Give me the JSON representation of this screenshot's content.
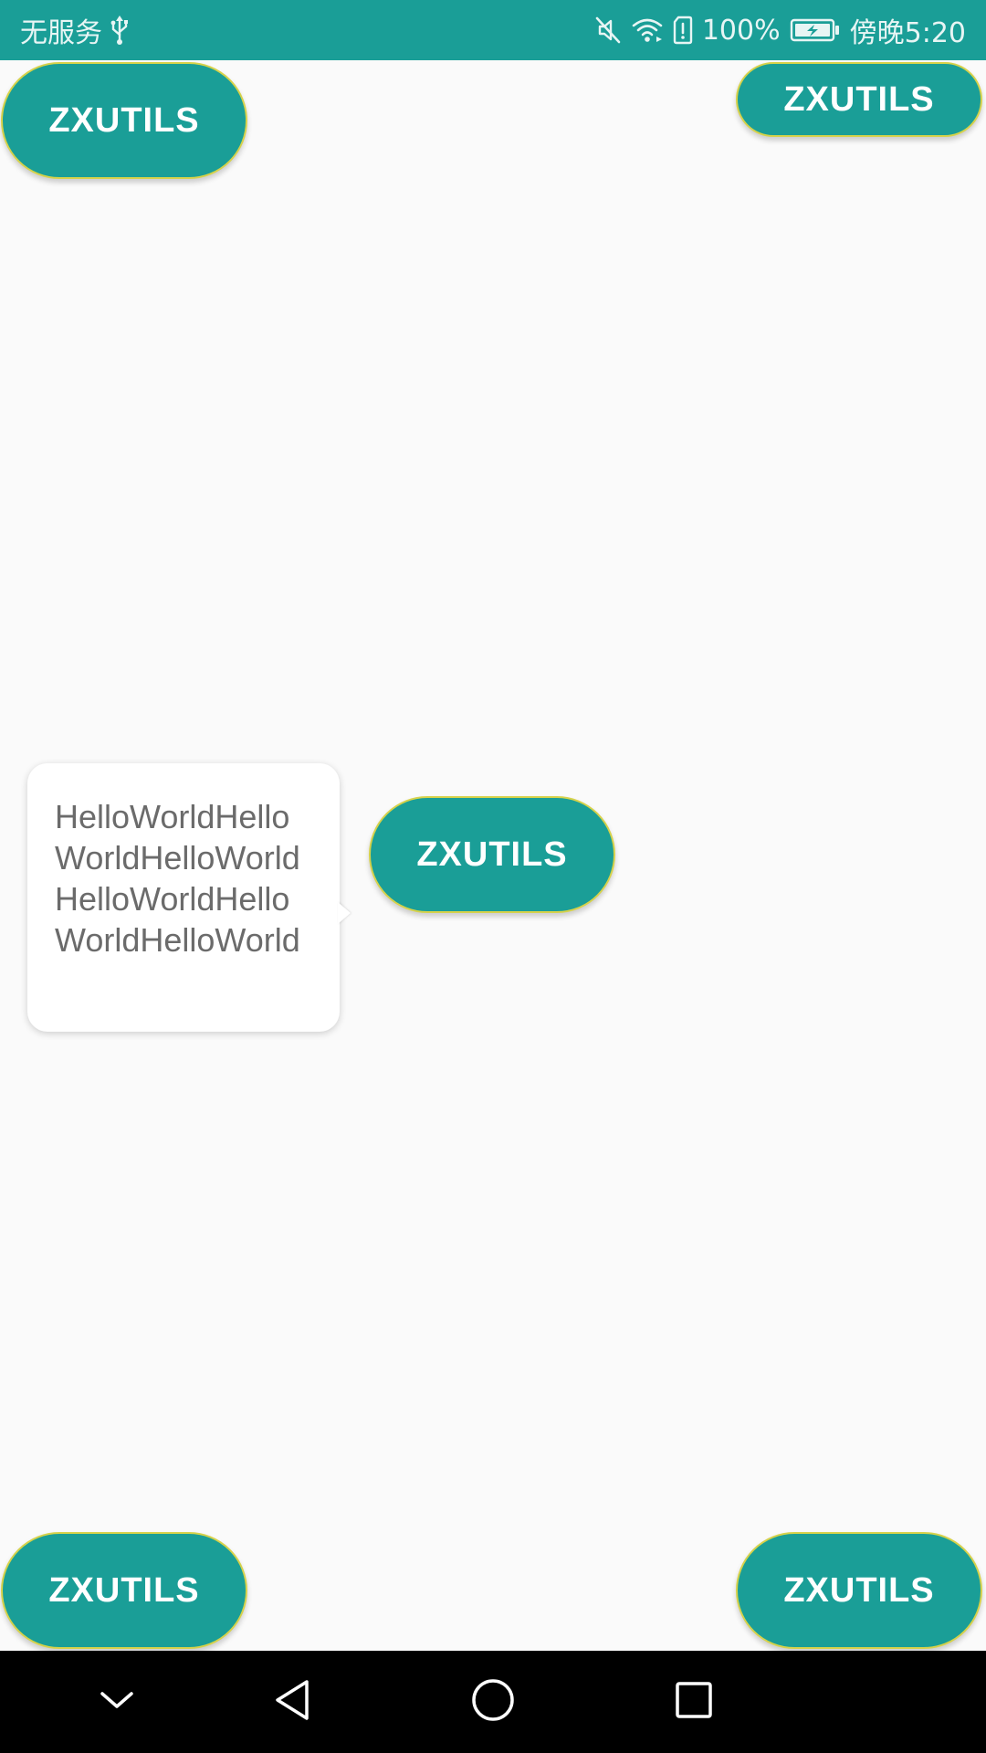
{
  "status_bar": {
    "carrier_text": "无服务",
    "battery_text": "100%",
    "time_text": "傍晚5:20",
    "icons": [
      "usb-icon",
      "mute-icon",
      "wifi-icon",
      "sim-alert-icon",
      "battery-charging-icon"
    ]
  },
  "buttons": {
    "top_left": "ZXUTILS",
    "top_right": "ZXUTILS",
    "center": "ZXUTILS",
    "bottom_left": "ZXUTILS",
    "bottom_right": "ZXUTILS"
  },
  "tooltip": {
    "text": "HelloWorldHelloWorldHelloWorldHelloWorldHelloWorldHelloWorld"
  },
  "nav_bar": {
    "icons": [
      "nav-down-icon",
      "nav-back-icon",
      "nav-home-icon",
      "nav-recents-icon"
    ]
  },
  "colors": {
    "primary": "#1A9E97",
    "button_border": "#D6D24A",
    "background": "#FAFAFA",
    "tooltip_text": "#6B6B6B",
    "nav_background": "#000000"
  }
}
